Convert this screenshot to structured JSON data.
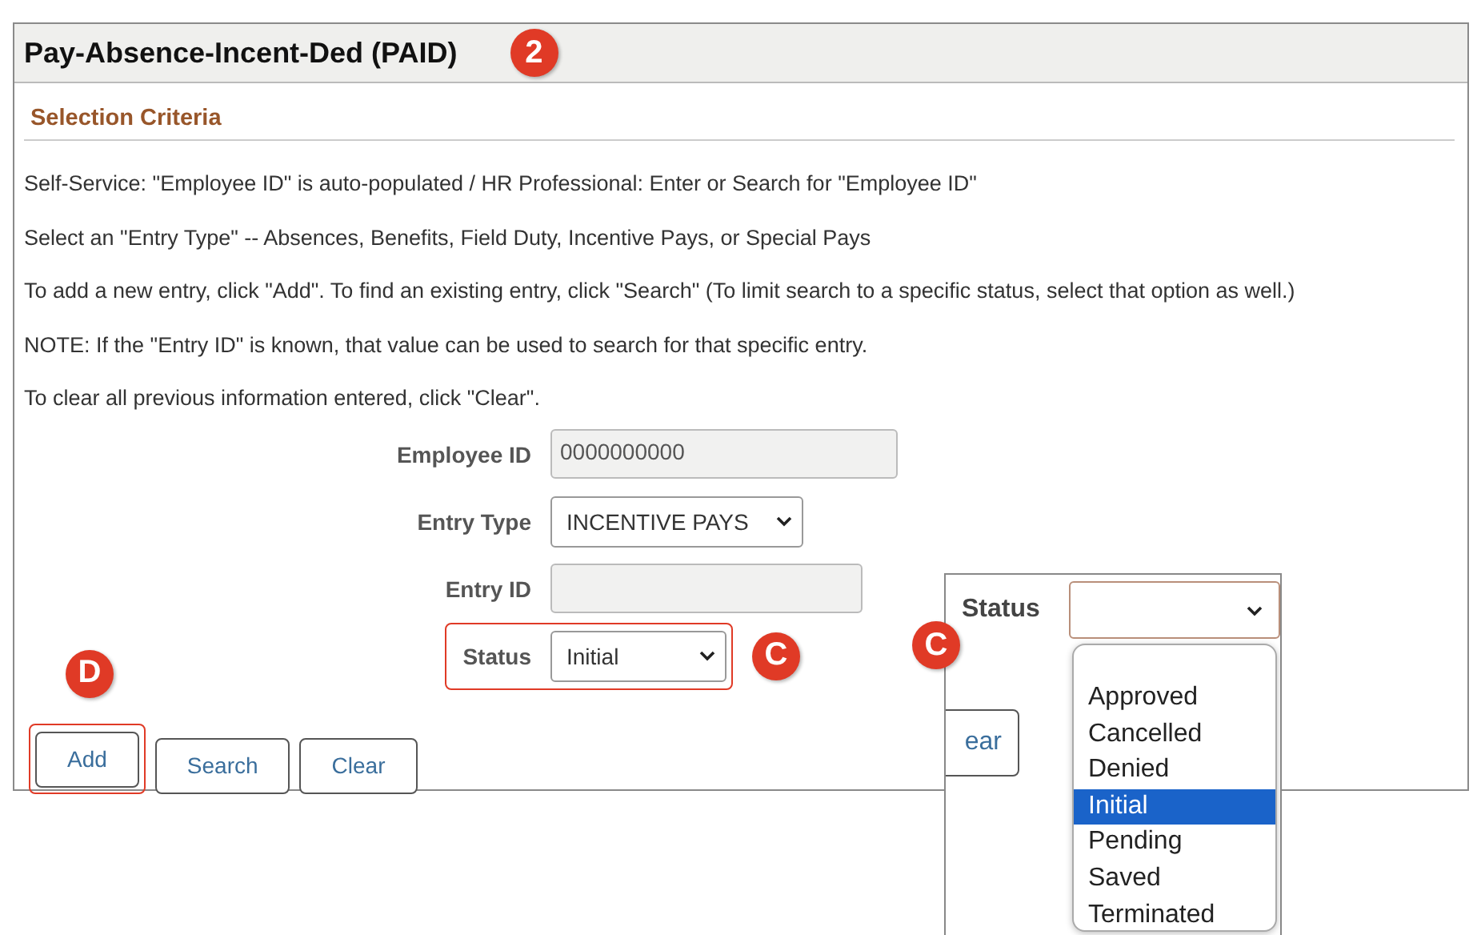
{
  "header": {
    "title": "Pay-Absence-Incent-Ded (PAID)",
    "callout": "2"
  },
  "section": {
    "title": "Selection Criteria",
    "instructions": [
      "Self-Service: \"Employee ID\" is auto-populated / HR Professional: Enter or Search for \"Employee ID\"",
      "Select an \"Entry Type\" -- Absences, Benefits, Field Duty, Incentive Pays, or Special Pays",
      "To add a new entry, click \"Add\". To find an existing entry, click \"Search\" (To limit search to a specific status, select that option as well.)",
      "NOTE: If the \"Entry ID\" is known, that value can be used to search for that specific entry.",
      "To clear all previous information entered, click \"Clear\"."
    ]
  },
  "fields": [
    {
      "kind": "text",
      "label": "Employee ID",
      "value": "0000000000",
      "disabled": true,
      "highlighted": false
    },
    {
      "kind": "select",
      "label": "Entry Type",
      "value": "INCENTIVE PAYS",
      "highlighted": false
    },
    {
      "kind": "text",
      "label": "Entry ID",
      "disabled": true,
      "highlighted": false
    },
    {
      "kind": "select",
      "label": "Status",
      "value": "Initial",
      "highlighted": true,
      "callout": "C"
    }
  ],
  "buttons": [
    {
      "label": "Add",
      "highlighted": true,
      "callout": "D"
    },
    {
      "label": "Search",
      "highlighted": false
    },
    {
      "label": "Clear",
      "highlighted": false
    }
  ],
  "inset": {
    "callout": "C",
    "label": "Status",
    "cut_button": "ear",
    "options": [
      {
        "label": "Approved",
        "selected": false
      },
      {
        "label": "Cancelled",
        "selected": false
      },
      {
        "label": "Denied",
        "selected": false
      },
      {
        "label": "Initial",
        "selected": true
      },
      {
        "label": "Pending",
        "selected": false
      },
      {
        "label": "Saved",
        "selected": false
      },
      {
        "label": "Terminated",
        "selected": false
      }
    ]
  }
}
